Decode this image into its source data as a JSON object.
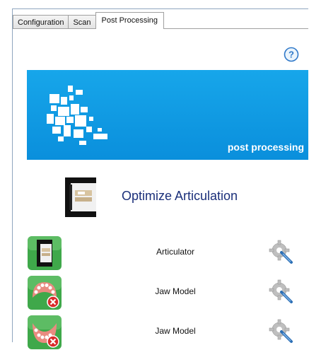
{
  "tabs": [
    {
      "label": "Configuration",
      "active": false
    },
    {
      "label": "Scan",
      "active": false
    },
    {
      "label": "Post Processing",
      "active": true
    }
  ],
  "help_icon": "help-icon",
  "banner": {
    "text": "post processing",
    "color": "#0a8fdc"
  },
  "optimize": {
    "label": "Optimize Articulation",
    "icon": "articulation-icon"
  },
  "items": [
    {
      "label": "Articulator",
      "icon": "articulator-icon",
      "settings_icon": "gear-wrench-icon"
    },
    {
      "label": "Jaw Model",
      "icon": "upper-jaw-icon",
      "settings_icon": "gear-wrench-icon"
    },
    {
      "label": "Jaw Model",
      "icon": "lower-jaw-icon",
      "settings_icon": "gear-wrench-icon"
    }
  ]
}
